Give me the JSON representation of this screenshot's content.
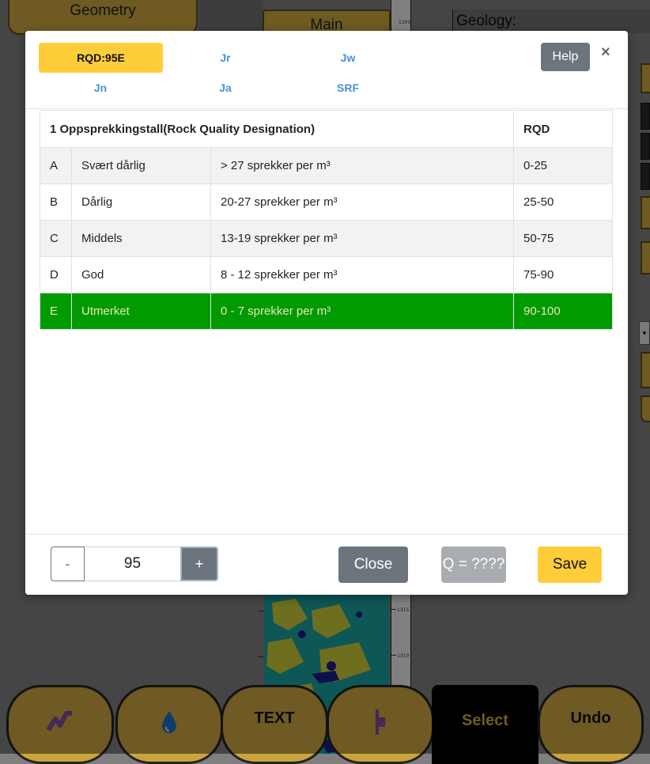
{
  "background": {
    "top_tabs": {
      "geometry": "Geometry",
      "main": "Main",
      "geology": "Geology:"
    },
    "ruler_labels": [
      "1300",
      "1315",
      "1310"
    ],
    "toolbar": {
      "line_tool_icon": "zigzag-line-icon",
      "water_icon": "water-drop-icon",
      "text_label": "TEXT",
      "marker_icon": "bar-marker-icon",
      "select_label": "Select",
      "undo_label": "Undo"
    }
  },
  "modal": {
    "tabs": [
      {
        "label": "RQD:95E",
        "active": true
      },
      {
        "label": "Jr",
        "active": false
      },
      {
        "label": "Jw",
        "active": false
      },
      {
        "label": "Jn",
        "active": false
      },
      {
        "label": "Ja",
        "active": false
      },
      {
        "label": "SRF",
        "active": false
      }
    ],
    "help_label": "Help",
    "close_symbol": "×",
    "table": {
      "headers": [
        "1 Oppsprekkingstall(Rock Quality Designation)",
        "RQD"
      ],
      "rows": [
        {
          "code": "A",
          "name": "Svært dårlig",
          "desc": "> 27 sprekker per m³",
          "rqd": "0-25"
        },
        {
          "code": "B",
          "name": "Dårlig",
          "desc": "20-27 sprekker per m³",
          "rqd": "25-50"
        },
        {
          "code": "C",
          "name": "Middels",
          "desc": "13-19 sprekker per m³",
          "rqd": "50-75"
        },
        {
          "code": "D",
          "name": "God",
          "desc": "8 - 12 sprekker per m³",
          "rqd": "75-90"
        },
        {
          "code": "E",
          "name": "Utmerket",
          "desc": "0 - 7 sprekker per m³",
          "rqd": "90-100"
        }
      ],
      "selected_code": "E"
    },
    "stepper": {
      "minus": "-",
      "value": "95",
      "plus": "+"
    },
    "close_label": "Close",
    "q_label": "Q = ????",
    "save_label": "Save"
  },
  "colors": {
    "accent": "#ffcd39",
    "selected_row": "#009b00",
    "tab_link": "#4a90d9",
    "secondary": "#6c757d",
    "app_gold": "#c9a53e"
  }
}
